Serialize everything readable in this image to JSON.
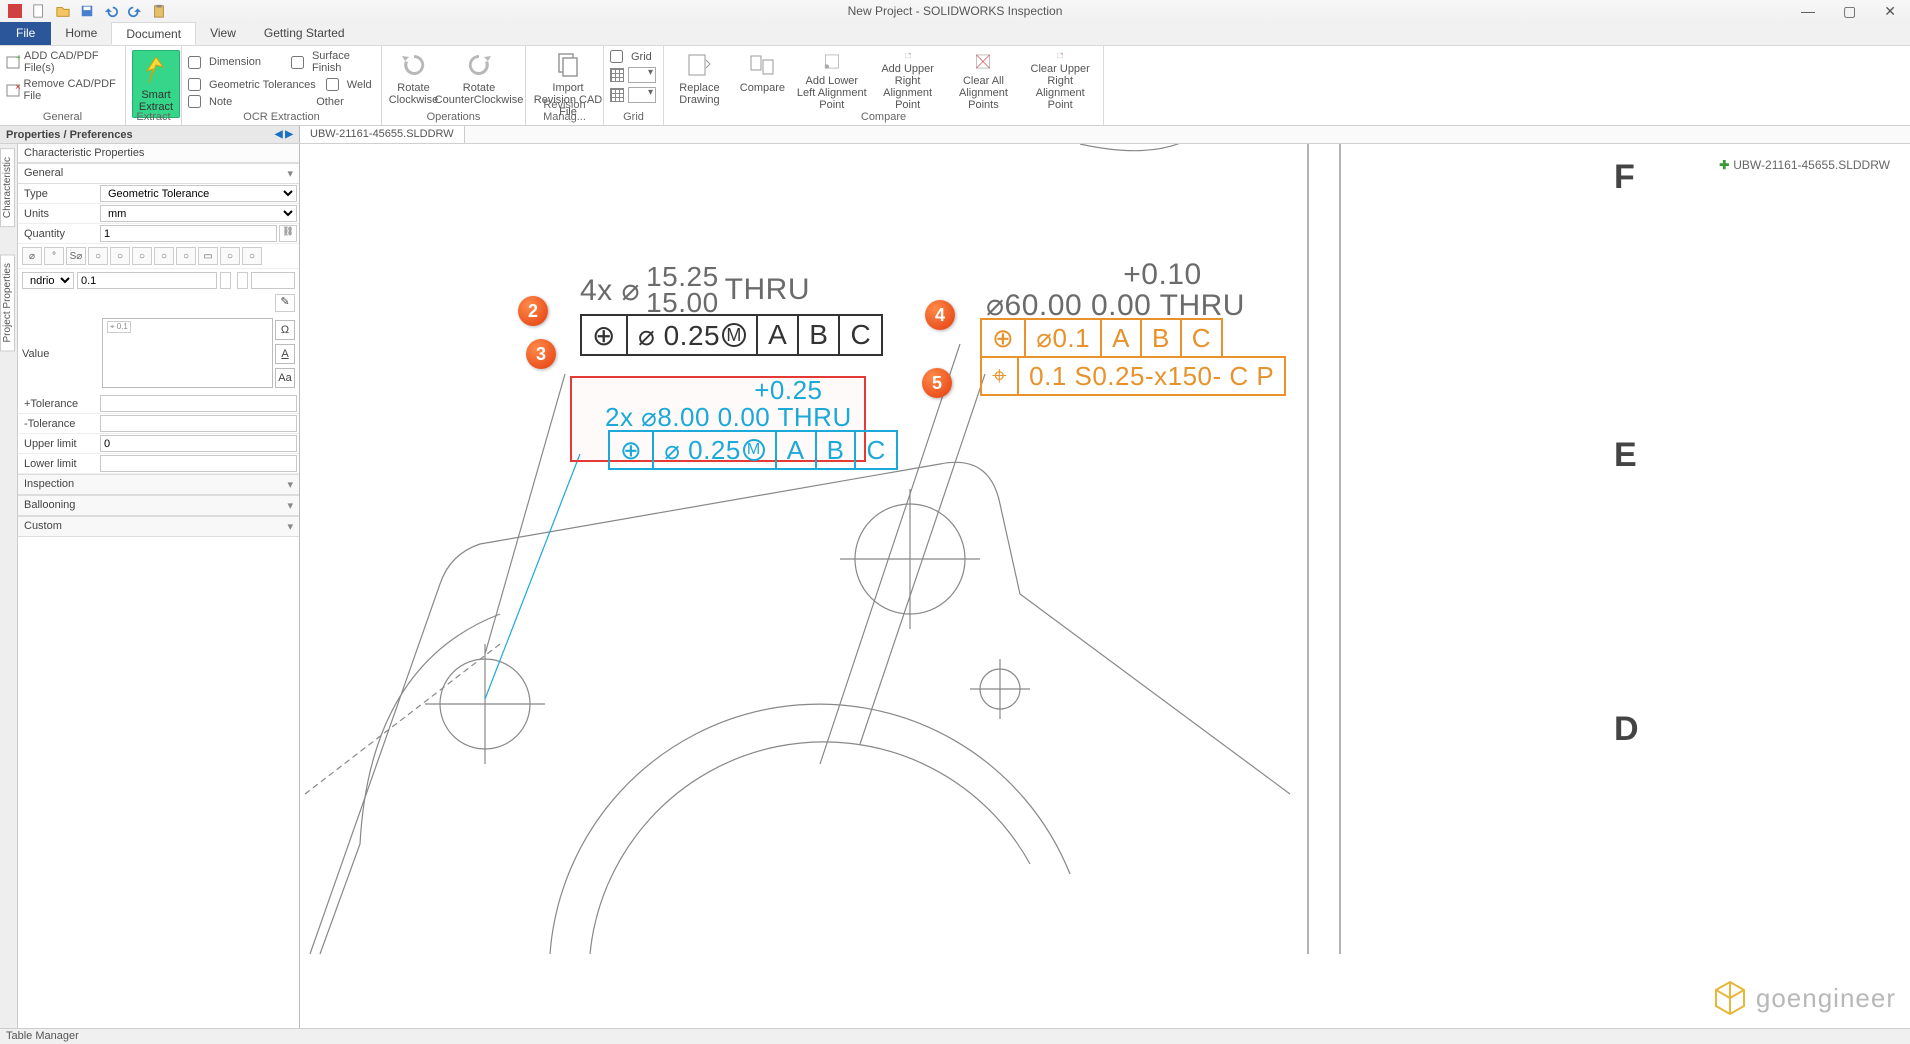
{
  "title": "New Project - SOLIDWORKS Inspection",
  "tabs": {
    "file": "File",
    "home": "Home",
    "document": "Document",
    "view": "View",
    "getting": "Getting Started"
  },
  "ribbon": {
    "general": {
      "add": "ADD CAD/PDF File(s)",
      "remove": "Remove CAD/PDF File",
      "label": "General"
    },
    "extract": {
      "smart": "Smart Extract",
      "label": "Extract"
    },
    "ocr": {
      "dim": "Dimension",
      "surf": "Surface Finish",
      "geo": "Geometric Tolerances",
      "weld": "Weld",
      "note": "Note",
      "other": "Other",
      "label": "OCR Extraction"
    },
    "ops": {
      "cw": "Rotate Clockwise",
      "ccw": "Rotate CounterClockwise",
      "label": "Operations"
    },
    "rev": {
      "import": "Import Revision CAD File",
      "label": "Revision Manag..."
    },
    "grid": {
      "grid": "Grid",
      "label": "Grid"
    },
    "compare": {
      "replace": "Replace Drawing",
      "compare": "Compare",
      "addll": "Add Lower Left Alignment Point",
      "addur": "Add Upper Right Alignment Point",
      "clearall": "Clear All Alignment Points",
      "clearur": "Clear Upper Right Alignment Point",
      "label": "Compare"
    }
  },
  "panel_tab": "Properties / Preferences",
  "doc_tab": "UBW-21161-45655.SLDDRW",
  "side": {
    "a": "Characteristic",
    "b": "Project Properties"
  },
  "props": {
    "hdr": "Characteristic Properties",
    "general": "General",
    "type_l": "Type",
    "type_v": "Geometric Tolerance",
    "units_l": "Units",
    "units_v": "mm",
    "qty_l": "Quantity",
    "qty_v": "1",
    "ndr": "ndrioty",
    "tol_in": "0.1",
    "value_l": "Value",
    "value_v": "⌖ 0.1",
    "ptol": "+Tolerance",
    "ntol": "-Tolerance",
    "ulim": "Upper limit",
    "ulim_v": "0",
    "llim": "Lower limit",
    "acc1": "Inspection",
    "acc2": "Ballooning",
    "acc3": "Custom"
  },
  "canvas": {
    "c1_pre": "4x ⌀",
    "c1_top": "15.25",
    "c1_bot": "15.00",
    "c1_suf": "THRU",
    "fcf1_tol": "⌀ 0.25",
    "fcf1_m": "M",
    "fcf_A": "A",
    "fcf_B": "B",
    "fcf_C": "C",
    "c3_tol": "+0.25",
    "c3_main": "2x ⌀8.00  0.00 THRU",
    "fcf3_tol": "⌀ 0.25",
    "fcf3_m": "M",
    "c4_tol": "+0.10",
    "c4_main": "⌀60.00  0.00 THRU",
    "fcf4_tol": "⌀0.1",
    "fcf5": "0.1 S0.25-x150- C P",
    "b2": "2",
    "b3": "3",
    "b4": "4",
    "b5": "5",
    "rF": "F",
    "rE": "E",
    "rD": "D",
    "tree": "UBW-21161-45655.SLDDRW",
    "logo": "goengineer"
  },
  "status": "Table Manager"
}
